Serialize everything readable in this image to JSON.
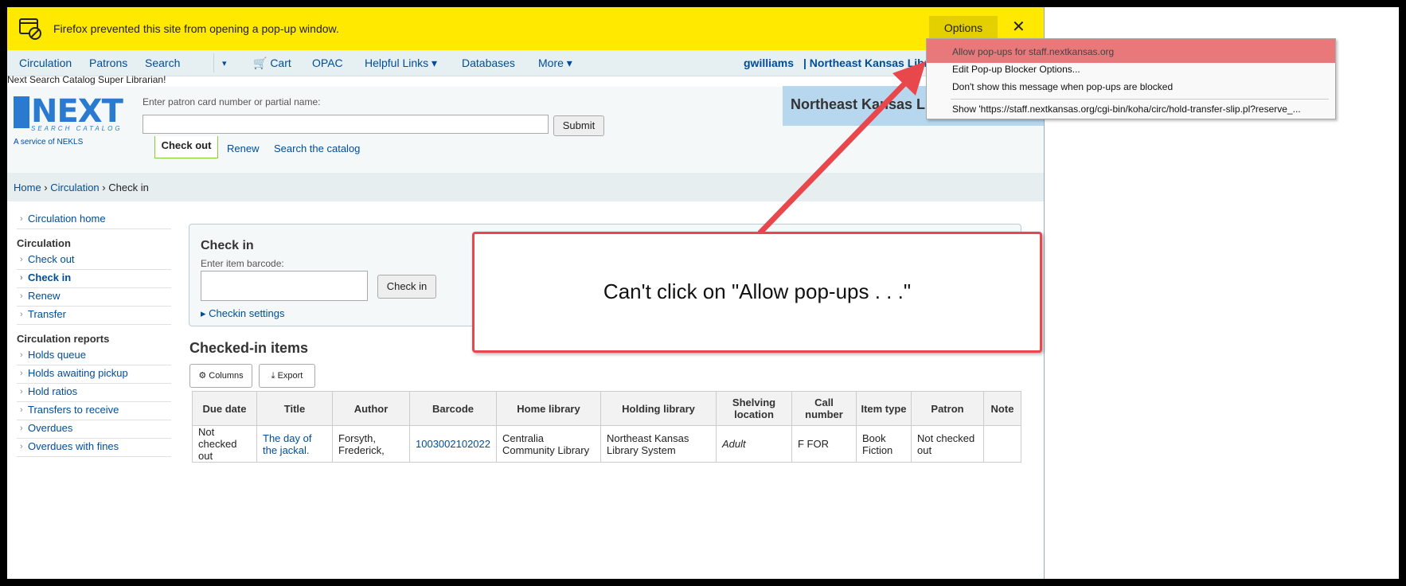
{
  "popup_bar": {
    "message": "Firefox prevented this site from opening a pop-up window.",
    "options_label": "Options",
    "close_glyph": "✕"
  },
  "popup_menu": {
    "items": [
      "Allow pop-ups for staff.nextkansas.org",
      "Edit Pop-up Blocker Options...",
      "Don't show this message when pop-ups are blocked",
      "Show 'https://staff.nextkansas.org/cgi-bin/koha/circ/hold-transfer-slip.pl?reserve_..."
    ]
  },
  "nav": {
    "items": [
      "Circulation",
      "Patrons",
      "Search",
      "▾",
      "🛒 Cart",
      "OPAC",
      "Helpful Links ▾",
      "Databases",
      "More ▾"
    ],
    "user": "gwilliams",
    "library": "|  Northeast Kansas Library"
  },
  "greeting": "Next Search Catalog Super Librarian!",
  "logo": {
    "word": "NEXT",
    "sub": "SEARCH CATALOG",
    "service": "A service of NEKLS"
  },
  "patron_search": {
    "label": "Enter patron card number or partial name:",
    "submit": "Submit"
  },
  "header_tabs": {
    "active": "Check out",
    "links": [
      "Renew",
      "Search the catalog"
    ]
  },
  "library_banner": "Northeast Kansas L",
  "breadcrumb": {
    "home": "Home",
    "sep": " › ",
    "circulation": "Circulation",
    "current": "Check in"
  },
  "sidebar": {
    "top": [
      "Circulation home"
    ],
    "circulation_heading": "Circulation",
    "circulation": [
      "Check out",
      "Check in",
      "Renew",
      "Transfer"
    ],
    "reports_heading": "Circulation reports",
    "reports": [
      "Holds queue",
      "Holds awaiting pickup",
      "Hold ratios",
      "Transfers to receive",
      "Overdues",
      "Overdues with fines"
    ]
  },
  "checkin": {
    "title": "Check in",
    "label": "Enter item barcode:",
    "button": "Check in",
    "settings": "Checkin settings"
  },
  "checked_in": {
    "title": "Checked-in items",
    "columns_btn": "Columns",
    "export_btn": "Export",
    "headers": [
      "Due date",
      "Title",
      "Author",
      "Barcode",
      "Home library",
      "Holding library",
      "Shelving location",
      "Call number",
      "Item type",
      "Patron",
      "Note"
    ],
    "rows": [
      [
        "Not checked out",
        "The day of the jackal.",
        "Forsyth, Frederick,",
        "1003002102022",
        "Centralia Community Library",
        "Northeast Kansas Library System",
        "Adult",
        "F FOR",
        "Book Fiction",
        "Not checked out",
        ""
      ]
    ]
  },
  "annotation": {
    "text": "Can't click on \"Allow pop-ups . . .\""
  },
  "colors": {
    "popup_bar": "#ffe900",
    "link": "#004d99",
    "annotation_red": "#e8474c"
  }
}
